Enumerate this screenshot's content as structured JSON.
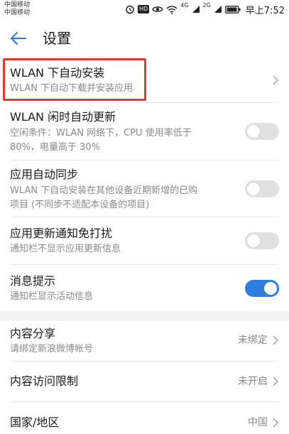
{
  "status_bar": {
    "carrier_1": "中国移动",
    "carrier_2": "中国移动",
    "hd_badge": "HD",
    "net_1": "4G",
    "net_2": "2G",
    "time": "早上7:52",
    "icons": [
      "alarm-icon",
      "hd-icon",
      "eye-icon",
      "wifi-icon",
      "signal-icon",
      "battery-icon"
    ]
  },
  "header": {
    "title": "设置",
    "back_icon": "back-arrow-icon"
  },
  "settings": [
    {
      "title": "WLAN 下自动安装",
      "desc": "WLAN 下自动下载并安装应用",
      "control": "chevron"
    },
    {
      "title": "WLAN 闲时自动更新",
      "desc_line1": "空闲条件：WLAN 网络下，CPU 使用率低于",
      "desc_line2": "80%，电量高于 30%",
      "control": "toggle",
      "on": false
    },
    {
      "title": "应用自动同步",
      "desc_line1": "WLAN 下自动安装在其他设备近期新增的已购",
      "desc_line2": "项目 (不同步不适配本设备的项目)",
      "control": "toggle",
      "on": false
    },
    {
      "title": "应用更新通知免打扰",
      "desc": "通知栏不显示应用更新信息",
      "control": "toggle",
      "on": false
    },
    {
      "title": "消息提示",
      "desc": "通知栏显示活动信息",
      "control": "toggle",
      "on": true
    }
  ],
  "settings_group2": [
    {
      "title": "内容分享",
      "desc": "请绑定新浪微博帐号",
      "value": "未绑定"
    },
    {
      "title": "内容访问限制",
      "value": "未开启"
    },
    {
      "title": "国家/地区",
      "value": "中国"
    }
  ],
  "colors": {
    "accent": "#2f7fe0",
    "highlight": "#e53935"
  }
}
